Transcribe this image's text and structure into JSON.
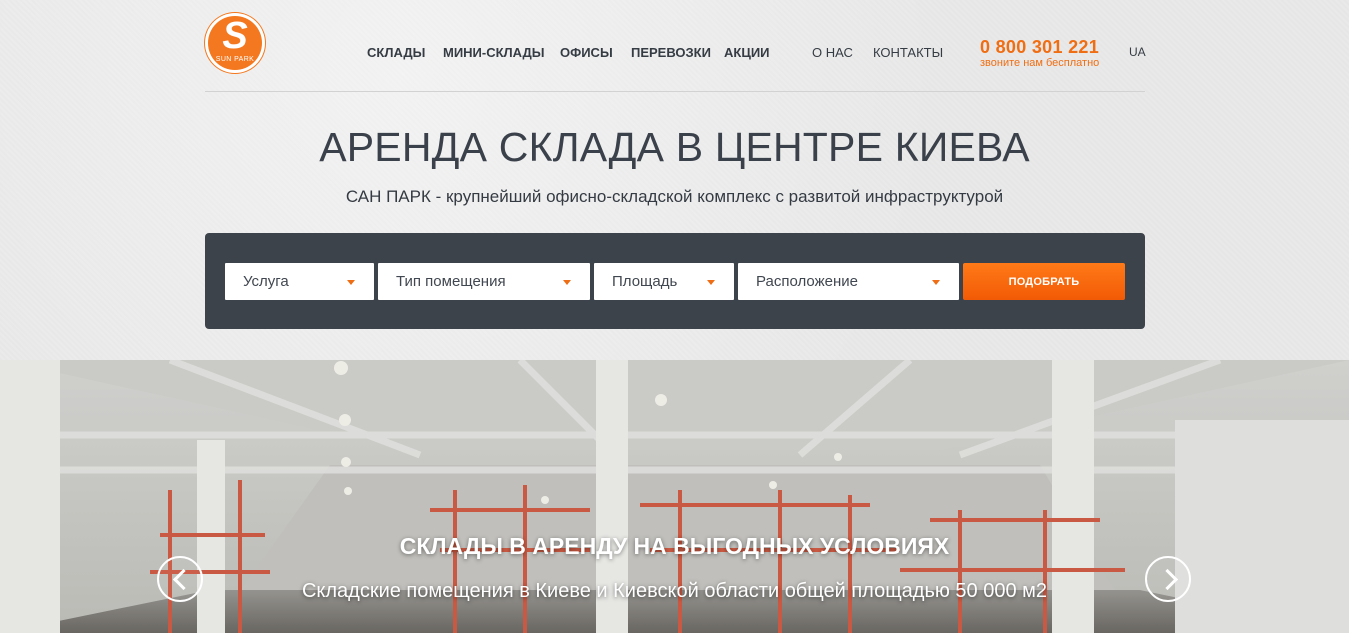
{
  "brand": {
    "logo_mark": "S",
    "logo_text": "SUN PARK"
  },
  "nav": {
    "items": [
      "СКЛАДЫ",
      "МИНИ-СКЛАДЫ",
      "ОФИСЫ",
      "ПЕРЕВОЗКИ",
      "АКЦИИ"
    ],
    "secondary": [
      "О НАС",
      "КОНТАКТЫ"
    ]
  },
  "contact": {
    "phone": "0 800 301 221",
    "phone_note": "звоните нам бесплатно",
    "language": "UA"
  },
  "hero": {
    "title": "АРЕНДА СКЛАДА В ЦЕНТРЕ КИЕВА",
    "subtitle": "САН ПАРК - крупнейший офисно-складской комплекс с развитой инфраструктурой"
  },
  "filters": {
    "service": "Услуга",
    "room_type": "Тип помещения",
    "area": "Площадь",
    "location": "Расположение",
    "submit_label": "ПОДОБРАТЬ"
  },
  "slider": {
    "title": "СКЛАДЫ В АРЕНДУ НА ВЫГОДНЫХ УСЛОВИЯХ",
    "description": "Складские помещения в Киеве и Киевской области общей площадью 50 000 м2"
  },
  "icons": {
    "dropdown": "chevron-down-icon",
    "previous": "chevron-left-icon",
    "next": "chevron-right-icon"
  },
  "colors": {
    "accent": "#f06e13",
    "panel": "#3d434b",
    "text": "#3b414a"
  }
}
